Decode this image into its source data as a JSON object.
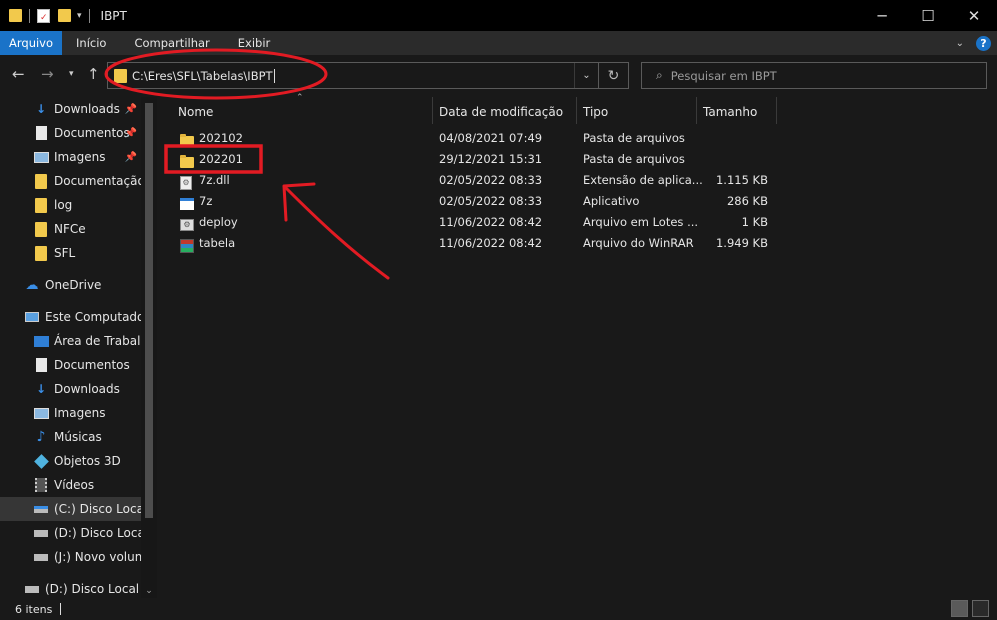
{
  "window": {
    "title": "IBPT",
    "controls": {
      "minimize": "─",
      "maximize": "☐",
      "close": "✕"
    }
  },
  "ribbon": {
    "tabs": [
      {
        "label": "Arquivo",
        "active": true
      },
      {
        "label": "Início",
        "active": false
      },
      {
        "label": "Compartilhar",
        "active": false
      },
      {
        "label": "Exibir",
        "active": false
      }
    ],
    "help": "?"
  },
  "navigation": {
    "address": "C:\\Eres\\SFL\\Tabelas\\IBPT",
    "search_placeholder": "Pesquisar em IBPT"
  },
  "sidebar": {
    "quick_access": [
      {
        "label": "Downloads",
        "icon": "download-icon",
        "pinned": true
      },
      {
        "label": "Documentos",
        "icon": "document-icon",
        "pinned": true
      },
      {
        "label": "Imagens",
        "icon": "image-icon",
        "pinned": true
      },
      {
        "label": "Documentação d",
        "icon": "folder-icon",
        "pinned": false
      },
      {
        "label": "log",
        "icon": "folder-icon",
        "pinned": false
      },
      {
        "label": "NFCe",
        "icon": "folder-icon",
        "pinned": false
      },
      {
        "label": "SFL",
        "icon": "folder-icon",
        "pinned": false
      }
    ],
    "onedrive": "OneDrive",
    "this_pc": "Este Computador",
    "this_pc_items": [
      {
        "label": "Área de Trabalho",
        "icon": "desktop-icon"
      },
      {
        "label": "Documentos",
        "icon": "document-icon"
      },
      {
        "label": "Downloads",
        "icon": "download-icon"
      },
      {
        "label": "Imagens",
        "icon": "image-icon"
      },
      {
        "label": "Músicas",
        "icon": "music-icon"
      },
      {
        "label": "Objetos 3D",
        "icon": "cube-icon"
      },
      {
        "label": "Vídeos",
        "icon": "video-icon"
      },
      {
        "label": "(C:) Disco Local",
        "icon": "drive-c-icon"
      },
      {
        "label": "(D:) Disco Local",
        "icon": "drive-icon"
      },
      {
        "label": "(J:) Novo volume",
        "icon": "drive-icon"
      }
    ],
    "network_drive": "(D:) Disco Local"
  },
  "columns": [
    "Nome",
    "Data de modificação",
    "Tipo",
    "Tamanho"
  ],
  "files": [
    {
      "name": "202102",
      "date": "04/08/2021 07:49",
      "type": "Pasta de arquivos",
      "size": "",
      "icon": "folder-icon"
    },
    {
      "name": "202201",
      "date": "29/12/2021 15:31",
      "type": "Pasta de arquivos",
      "size": "",
      "icon": "folder-icon"
    },
    {
      "name": "7z.dll",
      "date": "02/05/2022 08:33",
      "type": "Extensão de aplica...",
      "size": "1.115 KB",
      "icon": "dll-icon"
    },
    {
      "name": "7z",
      "date": "02/05/2022 08:33",
      "type": "Aplicativo",
      "size": "286 KB",
      "icon": "app-icon"
    },
    {
      "name": "deploy",
      "date": "11/06/2022 08:42",
      "type": "Arquivo em Lotes ...",
      "size": "1 KB",
      "icon": "batch-icon"
    },
    {
      "name": "tabela",
      "date": "11/06/2022 08:42",
      "type": "Arquivo do WinRAR",
      "size": "1.949 KB",
      "icon": "rar-icon"
    }
  ],
  "status": {
    "count": "6 itens"
  },
  "colors": {
    "accent": "#1a73c8",
    "annotation": "#e21b23",
    "folder": "#f2c94c",
    "background": "#191919"
  }
}
